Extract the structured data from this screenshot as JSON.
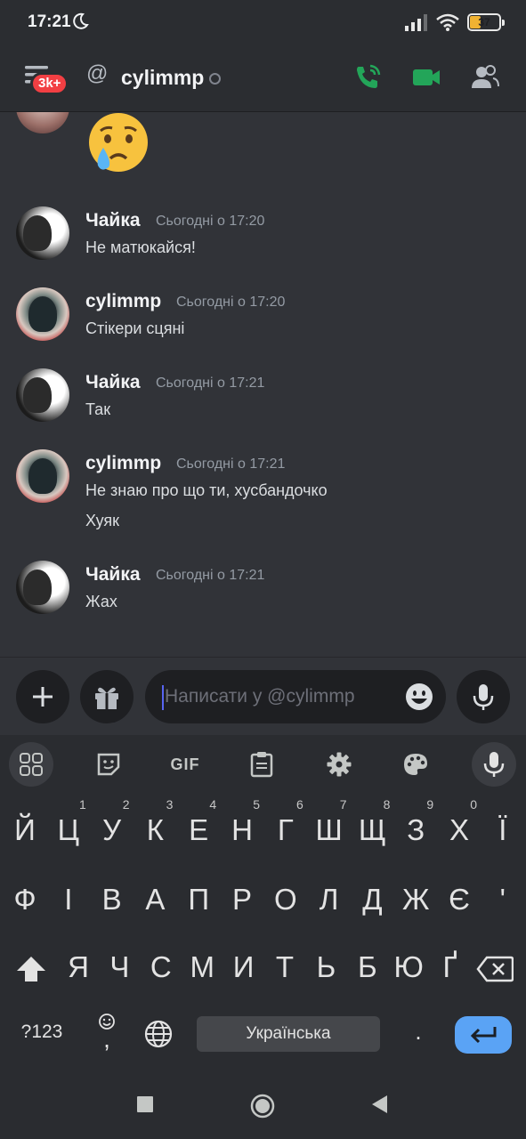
{
  "status_bar": {
    "time": "17:21",
    "battery": "37",
    "battery_level": 0.37
  },
  "header": {
    "badge": "3k+",
    "at": "@",
    "channel": "cylimmp"
  },
  "messages": [
    {
      "author": "Чайка",
      "time": "Сьогодні о 17:20",
      "lines": [
        "Не матюкайся!"
      ]
    },
    {
      "author": "cylimmp",
      "time": "Сьогодні о 17:20",
      "lines": [
        "Стікери сцяні"
      ]
    },
    {
      "author": "Чайка",
      "time": "Сьогодні о 17:21",
      "lines": [
        "Так"
      ]
    },
    {
      "author": "cylimmp",
      "time": "Сьогодні о 17:21",
      "lines": [
        "Не знаю про що ти, хусбандочко",
        "Хуяк"
      ]
    },
    {
      "author": "Чайка",
      "time": "Сьогодні о 17:21",
      "lines": [
        "Жах"
      ]
    }
  ],
  "composer": {
    "placeholder": "Написати у @cylimmp"
  },
  "keyboard": {
    "toolbar": {
      "gif": "GIF"
    },
    "row1": [
      "Й",
      "Ц",
      "У",
      "К",
      "Е",
      "Н",
      "Г",
      "Ш",
      "Щ",
      "З",
      "Х",
      "Ї"
    ],
    "row1_hints": [
      "",
      "1",
      "2",
      "3",
      "4",
      "5",
      "6",
      "7",
      "8",
      "9",
      "0",
      ""
    ],
    "row2": [
      "Ф",
      "І",
      "В",
      "А",
      "П",
      "Р",
      "О",
      "Л",
      "Д",
      "Ж",
      "Є",
      "'"
    ],
    "row3": [
      "Я",
      "Ч",
      "С",
      "М",
      "И",
      "Т",
      "Ь",
      "Б",
      "Ю",
      "Ґ"
    ],
    "symbols": "?123",
    "comma": ",",
    "space": "Українська",
    "period": "."
  },
  "colors": {
    "accent": "#5865f2",
    "call_green": "#23a559",
    "badge_red": "#f23f43",
    "enter_blue": "#5aa3f5"
  }
}
